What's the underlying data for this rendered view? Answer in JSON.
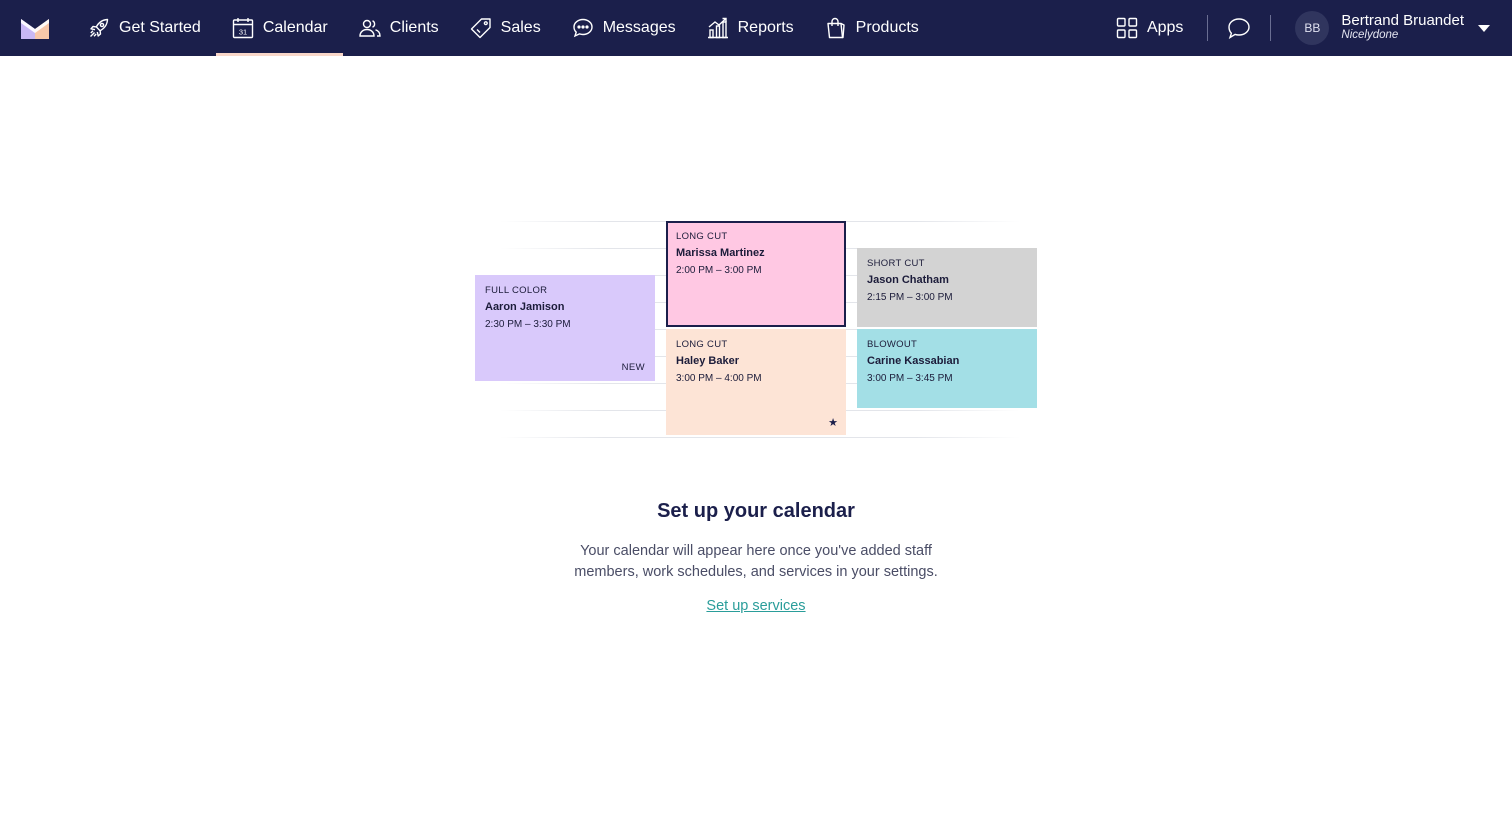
{
  "nav": {
    "items": [
      {
        "label": "Get Started",
        "icon": "rocket-icon"
      },
      {
        "label": "Calendar",
        "icon": "calendar-icon",
        "icon_text": "31",
        "active": true
      },
      {
        "label": "Clients",
        "icon": "users-icon"
      },
      {
        "label": "Sales",
        "icon": "tag-icon"
      },
      {
        "label": "Messages",
        "icon": "chat-bubble-icon"
      },
      {
        "label": "Reports",
        "icon": "bar-chart-icon"
      },
      {
        "label": "Products",
        "icon": "shopping-bag-icon"
      }
    ],
    "apps_label": "Apps",
    "user": {
      "initials": "BB",
      "name": "Bertrand Bruandet",
      "org": "Nicelydone"
    }
  },
  "colors": {
    "nav_bg": "#1b1f4b",
    "active_underline": "#f9d7c9",
    "link": "#2a9d9a",
    "card_purple": "#d9c9fb",
    "card_pink": "#ffc8e3",
    "card_peach": "#fde4d6",
    "card_gray": "#d3d3d3",
    "card_cyan": "#a3dfe6"
  },
  "illustration": {
    "cards": [
      {
        "service": "FULL COLOR",
        "client": "Aaron Jamison",
        "time": "2:30 PM – 3:30 PM",
        "badge": "NEW"
      },
      {
        "service": "LONG CUT",
        "client": "Marissa Martinez",
        "time": "2:00 PM – 3:00 PM"
      },
      {
        "service": "LONG CUT",
        "client": "Haley Baker",
        "time": "3:00 PM – 4:00 PM",
        "badge_icon": "star-icon"
      },
      {
        "service": "SHORT CUT",
        "client": "Jason Chatham",
        "time": "2:15 PM – 3:00 PM"
      },
      {
        "service": "BLOWOUT",
        "client": "Carine Kassabian",
        "time": "3:00 PM – 3:45 PM"
      }
    ]
  },
  "empty_state": {
    "title": "Set up your calendar",
    "body_line1": "Your calendar will appear here once you've added staff",
    "body_line2": "members, work schedules, and services in your settings.",
    "link": "Set up services"
  }
}
